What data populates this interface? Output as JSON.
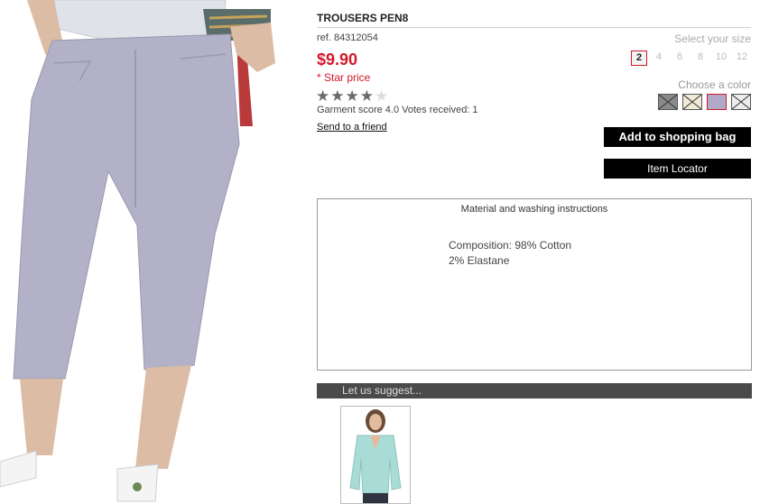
{
  "product": {
    "title": "TROUSERS PEN8",
    "ref": "ref. 84312054",
    "price": "$9.90",
    "star_price": "* Star price",
    "rating": {
      "value": 4,
      "max": 5,
      "text": "Garment score 4.0 Votes received: 1"
    },
    "send_link": "Send to a friend"
  },
  "size": {
    "label": "Select your size",
    "options": [
      "2",
      "4",
      "6",
      "8",
      "10",
      "12"
    ],
    "selected": "2"
  },
  "color": {
    "label": "Choose a color",
    "swatches": [
      {
        "name": "grey",
        "hex": "#8a8a8a",
        "crossed": true
      },
      {
        "name": "cream",
        "hex": "#f1ead9",
        "crossed": true
      },
      {
        "name": "lavender",
        "hex": "#b0aac8",
        "crossed": false,
        "selected": true
      },
      {
        "name": "white",
        "hex": "#ececec",
        "crossed": true
      }
    ]
  },
  "buttons": {
    "add": "Add to shopping bag",
    "locator": "Item Locator"
  },
  "material": {
    "title": "Material and washing instructions",
    "line1": "Composition: 98% Cotton",
    "line2": "2% Elastane"
  },
  "suggest": {
    "label": "Let us suggest..."
  },
  "colors": {
    "accent_red": "#d2182a",
    "trouser": "#b3b1c7",
    "suggest_sweater": "#a9dcd6"
  }
}
